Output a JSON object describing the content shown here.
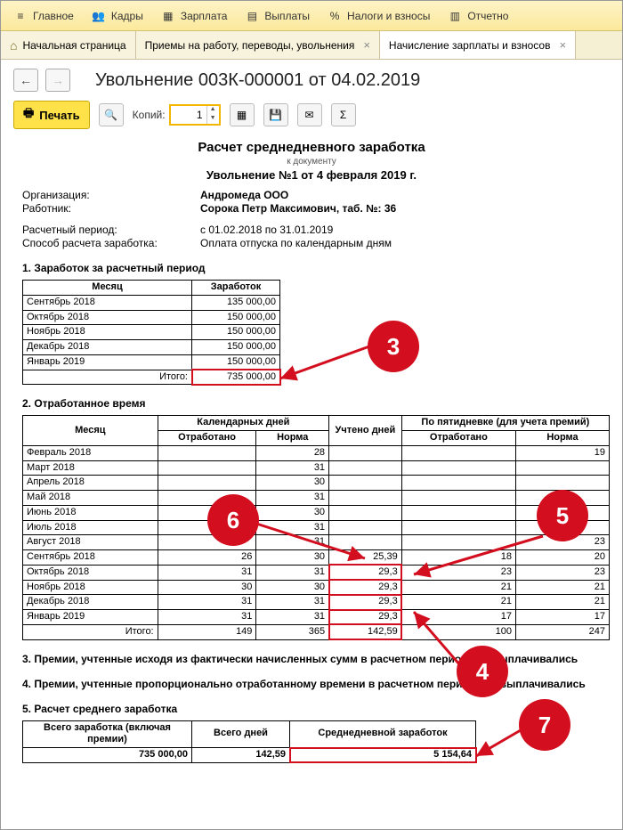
{
  "ribbon": [
    {
      "icon": "≡",
      "label": "Главное"
    },
    {
      "icon": "👥",
      "label": "Кадры"
    },
    {
      "icon": "🗓",
      "label": "Зарплата"
    },
    {
      "icon": "📑",
      "label": "Выплаты"
    },
    {
      "icon": "%",
      "label": "Налоги и взносы"
    },
    {
      "icon": "🗄",
      "label": "Отчетно"
    }
  ],
  "tabs": [
    {
      "label": "Начальная страница",
      "closable": false,
      "icon": "home"
    },
    {
      "label": "Приемы на работу, переводы, увольнения",
      "closable": true
    },
    {
      "label": "Начисление зарплаты и взносов",
      "closable": true
    }
  ],
  "document_title": "Увольнение 003К-000001 от 04.02.2019",
  "toolbar": {
    "print_label": "Печать",
    "copies_label": "Копий:",
    "copies_value": "1"
  },
  "report": {
    "title": "Расчет среднедневного заработка",
    "sub": "к документу",
    "sub2": "Увольнение №1 от 4 февраля 2019 г.",
    "info": {
      "org_label": "Организация:",
      "org_value": "Андромеда ООО",
      "emp_label": "Работник:",
      "emp_value": "Сорока Петр Максимович, таб. №: 36",
      "period_label": "Расчетный период:",
      "period_value": "с 01.02.2018 по 31.01.2019",
      "method_label": "Способ расчета заработка:",
      "method_value": "Оплата отпуска по календарным дням"
    },
    "sec1": "1. Заработок за расчетный период",
    "t1_headers": {
      "month": "Месяц",
      "earn": "Заработок"
    },
    "t1_rows": [
      {
        "m": "Сентябрь 2018",
        "v": "135 000,00"
      },
      {
        "m": "Октябрь 2018",
        "v": "150 000,00"
      },
      {
        "m": "Ноябрь 2018",
        "v": "150 000,00"
      },
      {
        "m": "Декабрь 2018",
        "v": "150 000,00"
      },
      {
        "m": "Январь 2019",
        "v": "150 000,00"
      }
    ],
    "t1_total_label": "Итого:",
    "t1_total": "735 000,00",
    "sec2": "2. Отработанное время",
    "t2_headers": {
      "month": "Месяц",
      "cal": "Календарных дней",
      "worked": "Отработано",
      "norm": "Норма",
      "acc": "Учтено дней",
      "five": "По пятидневке (для учета премий)",
      "fworked": "Отработано",
      "fnorm": "Норма"
    },
    "t2_rows": [
      {
        "m": "Февраль 2018",
        "cw": "",
        "cn": "28",
        "ad": "",
        "fw": "",
        "fn": "19"
      },
      {
        "m": "Март 2018",
        "cw": "",
        "cn": "31",
        "ad": "",
        "fw": "",
        "fn": ""
      },
      {
        "m": "Апрель 2018",
        "cw": "",
        "cn": "30",
        "ad": "",
        "fw": "",
        "fn": ""
      },
      {
        "m": "Май 2018",
        "cw": "",
        "cn": "31",
        "ad": "",
        "fw": "",
        "fn": ""
      },
      {
        "m": "Июнь 2018",
        "cw": "",
        "cn": "30",
        "ad": "",
        "fw": "",
        "fn": ""
      },
      {
        "m": "Июль 2018",
        "cw": "",
        "cn": "31",
        "ad": "",
        "fw": "",
        "fn": ""
      },
      {
        "m": "Август 2018",
        "cw": "",
        "cn": "31",
        "ad": "",
        "fw": "",
        "fn": "23"
      },
      {
        "m": "Сентябрь 2018",
        "cw": "26",
        "cn": "30",
        "ad": "25,39",
        "fw": "18",
        "fn": "20"
      },
      {
        "m": "Октябрь 2018",
        "cw": "31",
        "cn": "31",
        "ad": "29,3",
        "fw": "23",
        "fn": "23"
      },
      {
        "m": "Ноябрь 2018",
        "cw": "30",
        "cn": "30",
        "ad": "29,3",
        "fw": "21",
        "fn": "21"
      },
      {
        "m": "Декабрь 2018",
        "cw": "31",
        "cn": "31",
        "ad": "29,3",
        "fw": "21",
        "fn": "21"
      },
      {
        "m": "Январь 2019",
        "cw": "31",
        "cn": "31",
        "ad": "29,3",
        "fw": "17",
        "fn": "17"
      }
    ],
    "t2_total_label": "Итого:",
    "t2_total": {
      "cw": "149",
      "cn": "365",
      "ad": "142,59",
      "fw": "100",
      "fn": "247"
    },
    "sec3": "3. Премии, учтенные исходя из фактически начисленных сумм в расчетном периоде не выплачивались",
    "sec4": "4. Премии, учтенные пропорционально отработанному времени в расчетном периоде не выплачивались",
    "sec5": "5. Расчет среднего  заработка",
    "t5_headers": {
      "a": "Всего заработка (включая премии)",
      "b": "Всего дней",
      "c": "Среднедневной заработок"
    },
    "t5_row": {
      "a": "735 000,00",
      "b": "142,59",
      "c": "5 154,64"
    }
  },
  "callouts": {
    "c3": "3",
    "c4": "4",
    "c5": "5",
    "c6": "6",
    "c7": "7"
  }
}
